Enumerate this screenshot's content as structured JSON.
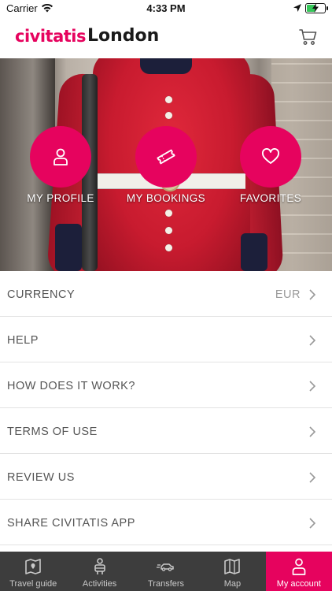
{
  "status": {
    "carrier": "Carrier",
    "time": "4:33 PM",
    "battery_level": 0.45
  },
  "header": {
    "brand": "civitatis",
    "city": "London",
    "cart_icon": "cart-icon"
  },
  "hero": {
    "actions": [
      {
        "label": "MY PROFILE",
        "icon": "user-icon"
      },
      {
        "label": "MY BOOKINGS",
        "icon": "ticket-icon"
      },
      {
        "label": "FAVORITES",
        "icon": "heart-icon"
      }
    ]
  },
  "menu": {
    "items": [
      {
        "label": "CURRENCY",
        "value": "EUR"
      },
      {
        "label": "HELP"
      },
      {
        "label": "HOW DOES IT WORK?"
      },
      {
        "label": "TERMS OF USE"
      },
      {
        "label": "REVIEW US"
      },
      {
        "label": "SHARE CIVITATIS APP"
      }
    ]
  },
  "tabbar": {
    "tabs": [
      {
        "label": "Travel guide",
        "icon": "map-book-icon"
      },
      {
        "label": "Activities",
        "icon": "guide-person-icon"
      },
      {
        "label": "Transfers",
        "icon": "car-icon"
      },
      {
        "label": "Map",
        "icon": "map-icon"
      },
      {
        "label": "My account",
        "icon": "user-icon",
        "active": true
      }
    ]
  },
  "colors": {
    "accent": "#e6035e",
    "tabbar_bg": "#3d3d3d"
  }
}
